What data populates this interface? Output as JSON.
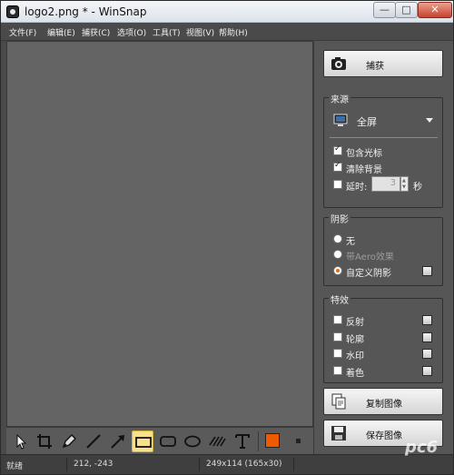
{
  "window": {
    "title": "logo2.png * - WinSnap",
    "minimize": "—",
    "maximize": "□",
    "close": "✕"
  },
  "menu": [
    "文件(F)",
    "编辑(E)",
    "捕获(C)",
    "选项(O)",
    "工具(T)",
    "视图(V)",
    "帮助(H)"
  ],
  "sidebar": {
    "capture_label": "捕获",
    "source": {
      "title": "来源",
      "mode": "全屏",
      "include_cursor": {
        "label": "包含光标",
        "checked": true
      },
      "clear_background": {
        "label": "清除背景",
        "checked": true
      },
      "delay": {
        "label": "延时:",
        "value": "3",
        "unit": "秒",
        "checked": false
      }
    },
    "shadow": {
      "title": "阴影",
      "options": [
        {
          "label": "无",
          "selected": false,
          "enabled": true
        },
        {
          "label": "带Aero效果",
          "selected": false,
          "enabled": false
        },
        {
          "label": "自定义阴影",
          "selected": true,
          "enabled": true
        }
      ]
    },
    "effects": {
      "title": "特效",
      "items": [
        {
          "label": "反射",
          "checked": false
        },
        {
          "label": "轮廓",
          "checked": false
        },
        {
          "label": "水印",
          "checked": false
        },
        {
          "label": "着色",
          "checked": false
        }
      ]
    },
    "copy_label": "复制图像",
    "save_label": "保存图像"
  },
  "toolbar": {
    "tools": [
      "pointer-icon",
      "crop-icon",
      "pen-icon",
      "line-icon",
      "arrow-icon",
      "rectangle-icon",
      "rounded-rectangle-icon",
      "ellipse-icon",
      "hatch-icon",
      "text-icon"
    ],
    "active_tool": "rectangle-icon",
    "color": "#ee5a00"
  },
  "status": {
    "state": "就绪",
    "cursor": "212, -243",
    "size": "249x114 (165x30)"
  },
  "watermark": "pc6"
}
